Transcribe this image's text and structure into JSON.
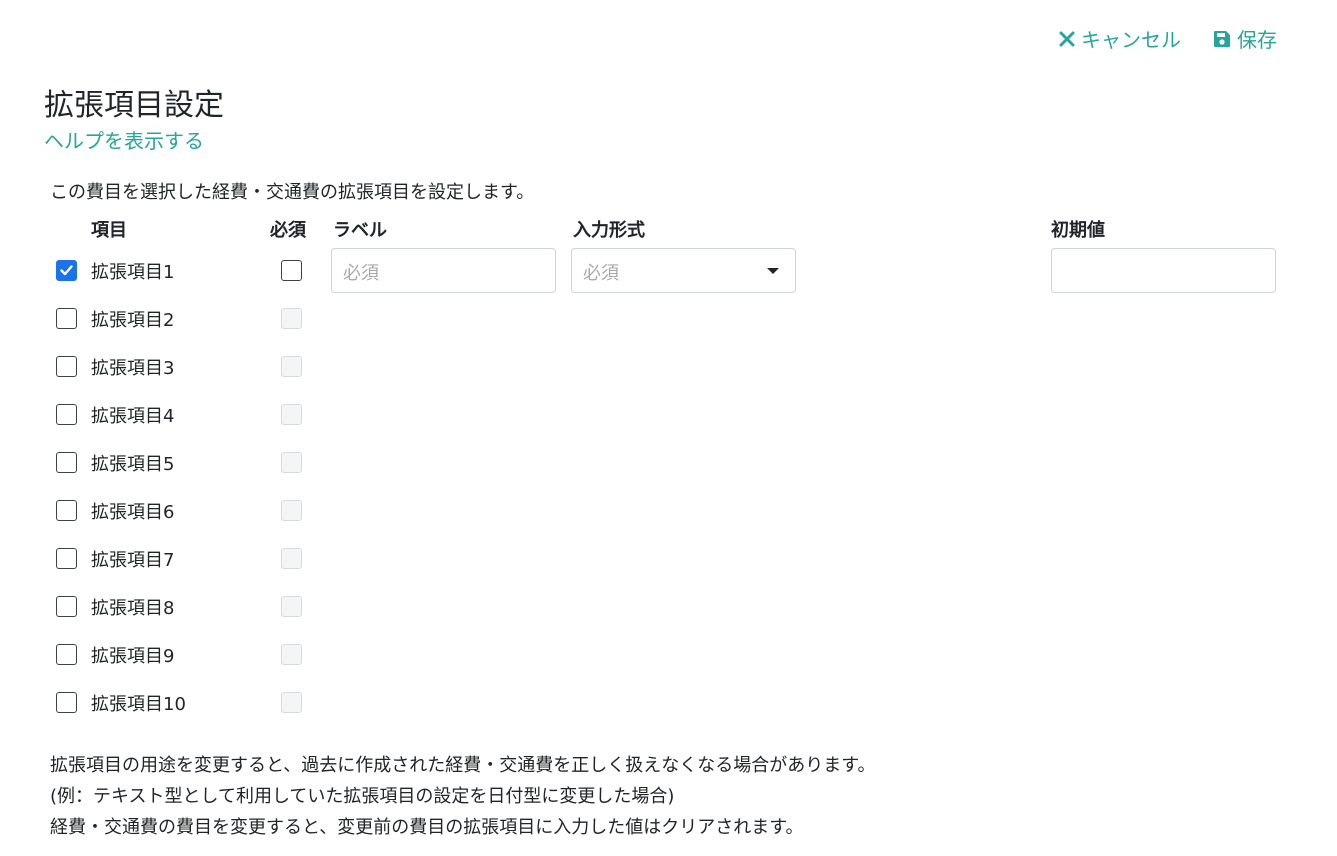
{
  "toolbar": {
    "cancel_label": "キャンセル",
    "save_label": "保存",
    "accent_color": "#26a69a"
  },
  "page": {
    "title": "拡張項目設定",
    "help_link": "ヘルプを表示する",
    "intro": "この費目を選択した経費・交通費の拡張項目を設定します。"
  },
  "table": {
    "headers": {
      "item": "項目",
      "required": "必須",
      "label": "ラベル",
      "input_type": "入力形式",
      "default_value": "初期値"
    },
    "rows": [
      {
        "label": "拡張項目1",
        "checked": true,
        "required_enabled": true
      },
      {
        "label": "拡張項目2",
        "checked": false,
        "required_enabled": false
      },
      {
        "label": "拡張項目3",
        "checked": false,
        "required_enabled": false
      },
      {
        "label": "拡張項目4",
        "checked": false,
        "required_enabled": false
      },
      {
        "label": "拡張項目5",
        "checked": false,
        "required_enabled": false
      },
      {
        "label": "拡張項目6",
        "checked": false,
        "required_enabled": false
      },
      {
        "label": "拡張項目7",
        "checked": false,
        "required_enabled": false
      },
      {
        "label": "拡張項目8",
        "checked": false,
        "required_enabled": false
      },
      {
        "label": "拡張項目9",
        "checked": false,
        "required_enabled": false
      },
      {
        "label": "拡張項目10",
        "checked": false,
        "required_enabled": false
      }
    ],
    "first_row_inputs": {
      "label_placeholder": "必須",
      "input_type_placeholder": "必須",
      "default_value": ""
    }
  },
  "notes": [
    "拡張項目の用途を変更すると、過去に作成された経費・交通費を正しく扱えなくなる場合があります。",
    "(例：テキスト型として利用していた拡張項目の設定を日付型に変更した場合)",
    "経費・交通費の費目を変更すると、変更前の費目の拡張項目に入力した値はクリアされます。"
  ]
}
